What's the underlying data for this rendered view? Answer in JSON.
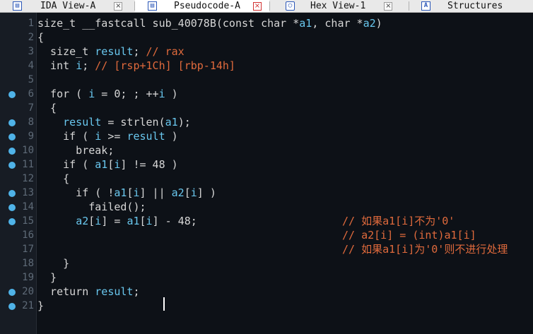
{
  "tabs": [
    {
      "label": "IDA View-A",
      "icon": "ida-view-icon",
      "close": "×",
      "active": false
    },
    {
      "label": "Pseudocode-A",
      "icon": "pseudocode-icon",
      "close": "×",
      "active": true
    },
    {
      "label": "Hex View-1",
      "icon": "hex-view-icon",
      "close": "×",
      "active": false
    },
    {
      "label": "Structures",
      "icon": "structures-icon",
      "close": "",
      "active": false
    }
  ],
  "code": {
    "lines": [
      {
        "n": "1",
        "bp": false,
        "text": "size_t __fastcall sub_40078B(const char *a1, char *a2)"
      },
      {
        "n": "2",
        "bp": false,
        "text": "{"
      },
      {
        "n": "3",
        "bp": false,
        "text": "  size_t result; // rax"
      },
      {
        "n": "4",
        "bp": false,
        "text": "  int i; // [rsp+1Ch] [rbp-14h]"
      },
      {
        "n": "5",
        "bp": false,
        "text": ""
      },
      {
        "n": "6",
        "bp": true,
        "text": "  for ( i = 0; ; ++i )"
      },
      {
        "n": "7",
        "bp": false,
        "text": "  {"
      },
      {
        "n": "8",
        "bp": true,
        "text": "    result = strlen(a1);"
      },
      {
        "n": "9",
        "bp": true,
        "text": "    if ( i >= result )"
      },
      {
        "n": "10",
        "bp": true,
        "text": "      break;"
      },
      {
        "n": "11",
        "bp": true,
        "text": "    if ( a1[i] != 48 )"
      },
      {
        "n": "12",
        "bp": false,
        "text": "    {"
      },
      {
        "n": "13",
        "bp": true,
        "text": "      if ( !a1[i] || a2[i] )"
      },
      {
        "n": "14",
        "bp": true,
        "text": "        failed();"
      },
      {
        "n": "15",
        "bp": true,
        "text": "      a2[i] = a1[i] - 48;"
      },
      {
        "n": "16",
        "bp": false,
        "text": ""
      },
      {
        "n": "17",
        "bp": false,
        "text": ""
      },
      {
        "n": "18",
        "bp": false,
        "text": "    }"
      },
      {
        "n": "19",
        "bp": false,
        "text": "  }"
      },
      {
        "n": "20",
        "bp": true,
        "text": "  return result;"
      },
      {
        "n": "21",
        "bp": true,
        "text": "}"
      }
    ],
    "comments": [
      {
        "line": 15,
        "text": "// 如果a1[i]不为'0'"
      },
      {
        "line": 16,
        "text": "// a2[i] = (int)a1[i]"
      },
      {
        "line": 17,
        "text": "// 如果a1[i]为'0'则不进行处理"
      }
    ]
  },
  "colors": {
    "background": "#0d1117",
    "variable": "#69c7ee",
    "comment": "#e06a3c",
    "breakpoint": "#4fb3e8"
  }
}
